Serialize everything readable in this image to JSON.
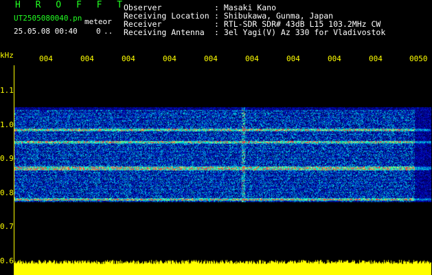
{
  "header": {
    "title": "H R O F F T",
    "filename": "UT2505080040.pn",
    "mode": "meteor",
    "datetime": "25.05.08 00:40",
    "count": "0",
    "info": [
      {
        "label": "Observer",
        "value": ": Masaki Kano"
      },
      {
        "label": "Receiving Location",
        "value": ": Shibukawa, Gunma, Japan"
      },
      {
        "label": "Receiver",
        "value": ": RTL-SDR SDR# 43dB L15 103.2MHz CW"
      },
      {
        "label": "Receiving Antenna",
        "value": ": 3el Yagi(V) Az 330 for Vladivostok"
      }
    ]
  },
  "axis": {
    "unit": "kHz",
    "y_ticks": [
      "1.1",
      "1.0",
      "0.9",
      "0.8",
      "0.7",
      "0.6"
    ],
    "x_ticks": [
      "004",
      "004",
      "004",
      "004",
      "004",
      "004",
      "004",
      "004",
      "004",
      "0050"
    ]
  },
  "spectrogram": {
    "band_top_khz": 1.05,
    "band_bottom_khz": 0.77,
    "carrier_lines_khz": [
      0.873,
      0.868,
      0.778,
      0.948,
      0.985
    ],
    "meteor_event_column_fraction": 0.55,
    "colors": {
      "background": "#000000",
      "noise": "#0000c0",
      "mid": "#00ffff",
      "high": "#ff3030",
      "total_power": "#ffff00"
    }
  }
}
